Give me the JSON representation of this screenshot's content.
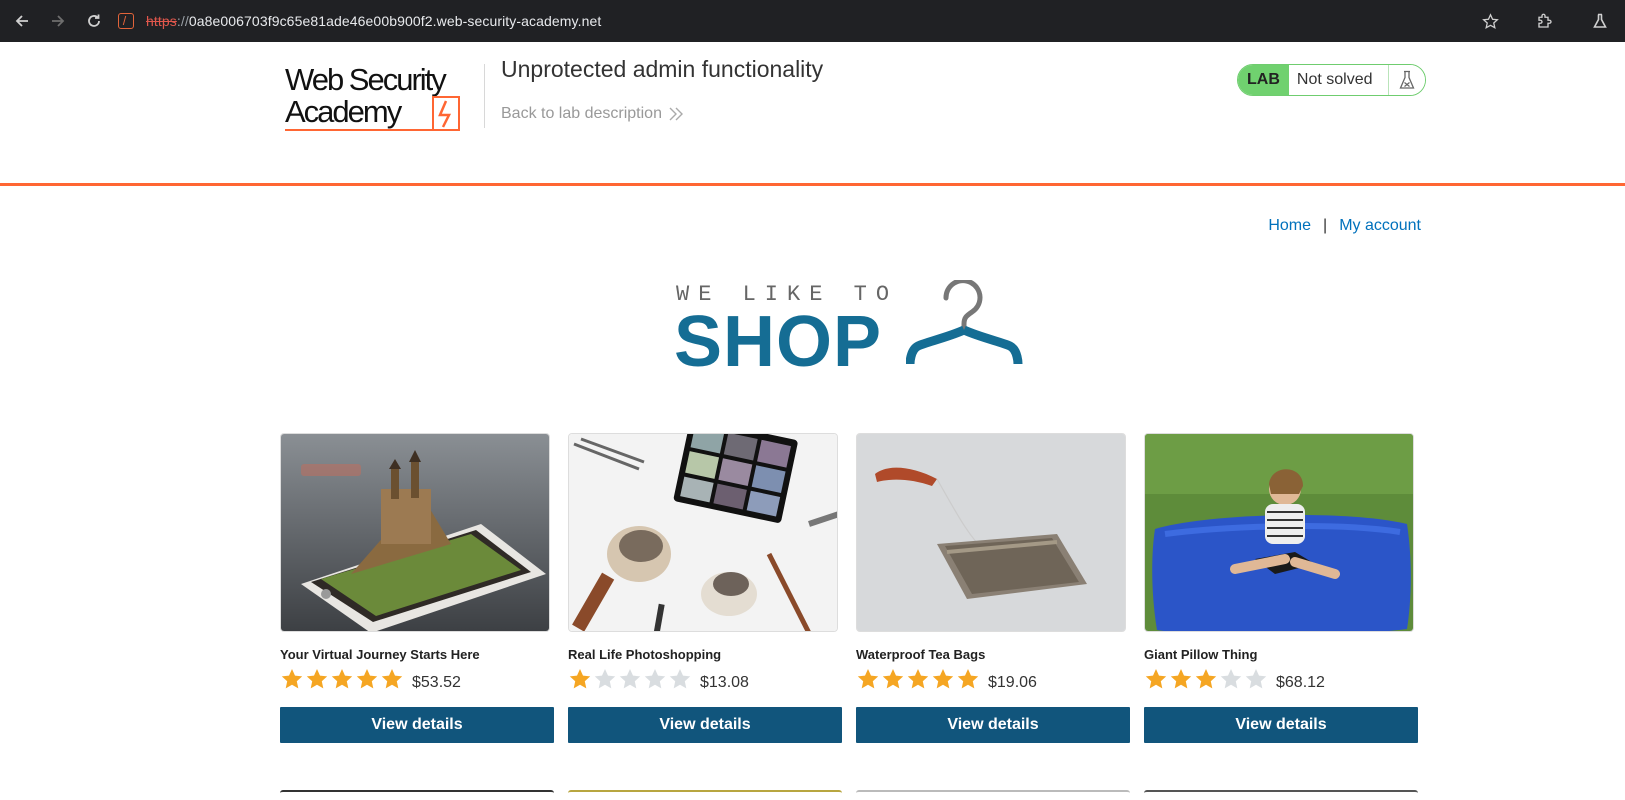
{
  "browser": {
    "url_scheme": "https",
    "url_sep": "://",
    "url_host": "0a8e006703f9c65e81ade46e00b900f2.web-security-academy.net"
  },
  "lab": {
    "logo_line1": "Web Security",
    "logo_line2": "Academy",
    "title": "Unprotected admin functionality",
    "back_link": "Back to lab description",
    "badge": "LAB",
    "status": "Not solved"
  },
  "nav": {
    "home": "Home",
    "separator": "|",
    "account": "My account"
  },
  "hero": {
    "line1": "WE LIKE TO",
    "line2": "SHOP"
  },
  "products": [
    {
      "name": "Your Virtual Journey Starts Here",
      "rating": 5,
      "price": "$53.52",
      "button": "View details",
      "image": "castle-phone"
    },
    {
      "name": "Real Life Photoshopping",
      "rating": 1,
      "price": "$13.08",
      "button": "View details",
      "image": "makeup-brushes"
    },
    {
      "name": "Waterproof Tea Bags",
      "rating": 5,
      "price": "$19.06",
      "button": "View details",
      "image": "tea-bag"
    },
    {
      "name": "Giant Pillow Thing",
      "rating": 3,
      "price": "$68.12",
      "button": "View details",
      "image": "blue-pillow"
    }
  ],
  "colors": {
    "accent_orange": "#ff6633",
    "shop_blue": "#156d94",
    "button_blue": "#11557c",
    "star_gold": "#f5a623",
    "star_grey": "#d9dde0",
    "lab_green": "#70d16f"
  }
}
